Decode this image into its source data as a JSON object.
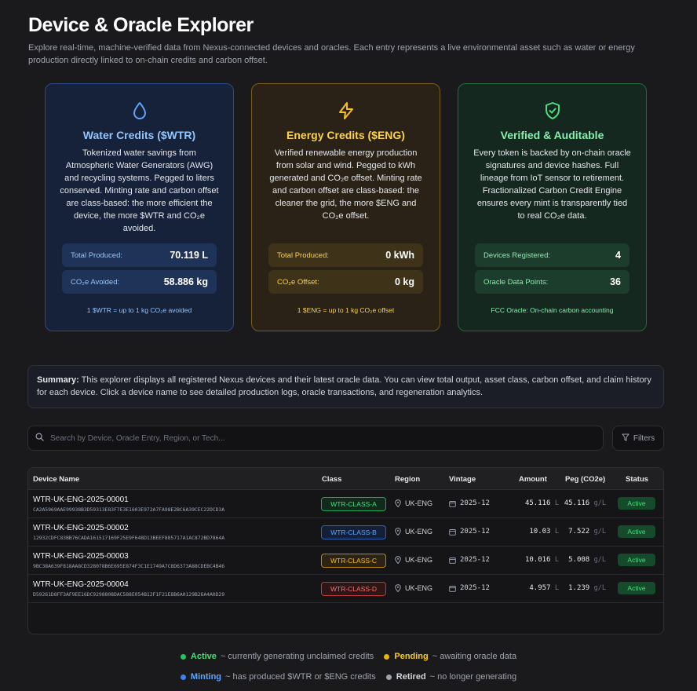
{
  "header": {
    "title": "Device & Oracle Explorer",
    "description": "Explore real-time, machine-verified data from Nexus-connected devices and oracles. Each entry represents a live environmental asset such as water or energy production directly linked to on-chain credits and carbon offset."
  },
  "cards": {
    "water": {
      "icon": "droplet-icon",
      "title": "Water Credits ($WTR)",
      "body": "Tokenized water savings from Atmospheric Water Generators (AWG) and recycling systems. Pegged to liters conserved. Minting rate and carbon offset are class-based: the more efficient the device, the more $WTR and CO₂e avoided.",
      "stat1_label": "Total Produced:",
      "stat1_value": "70.119 L",
      "stat2_label": "CO₂e Avoided:",
      "stat2_value": "58.886 kg",
      "footer": "1 $WTR = up to 1 kg CO₂e avoided",
      "accent": "#93c5fd"
    },
    "energy": {
      "icon": "lightning-icon",
      "title": "Energy Credits ($ENG)",
      "body": "Verified renewable energy production from solar and wind. Pegged to kWh generated and CO₂e offset. Minting rate and carbon offset are class-based: the cleaner the grid, the more $ENG and CO₂e offset.",
      "stat1_label": "Total Produced:",
      "stat1_value": "0 kWh",
      "stat2_label": "CO₂e Offset:",
      "stat2_value": "0 kg",
      "footer": "1 $ENG = up to 1 kg CO₂e offset",
      "accent": "#fcd34d"
    },
    "verify": {
      "icon": "shield-check-icon",
      "title": "Verified & Auditable",
      "body": "Every token is backed by on-chain oracle signatures and device hashes. Full lineage from IoT sensor to retirement. Fractionalized Carbon Credit Engine ensures every mint is transparently tied to real CO₂e data.",
      "stat1_label": "Devices Registered:",
      "stat1_value": "4",
      "stat2_label": "Oracle Data Points:",
      "stat2_value": "36",
      "footer": "FCC Oracle: On-chain carbon accounting",
      "accent": "#86efac"
    }
  },
  "summary": {
    "lead": "Summary:",
    "text": " This explorer displays all registered Nexus devices and their latest oracle data. You can view total output, asset class, carbon offset, and claim history for each device. Click a device name to see detailed production logs, oracle transactions, and regeneration analytics."
  },
  "search": {
    "placeholder": "Search by Device, Oracle Entry, Region, or Tech...",
    "value": ""
  },
  "filters_label": "Filters",
  "table": {
    "columns": [
      "Device Name",
      "Class",
      "Region",
      "Vintage",
      "Amount",
      "Peg (CO2e)",
      "Status"
    ],
    "rows": [
      {
        "name": "WTR-UK-ENG-2025-00001",
        "hash": "CA2A5969AAE99938B3D59313E83F7E3E1603E972A7FA98E2BC6A39CEC22DCD3A",
        "class": "WTR-CLASS-A",
        "region": "UK-ENG",
        "vintage": "2025-12",
        "amount": "45.116",
        "amount_unit": "L",
        "peg": "45.116",
        "peg_unit": "g/L",
        "status": "Active"
      },
      {
        "name": "WTR-UK-ENG-2025-00002",
        "hash": "12932CDFC83BB76CADA161517169F25E9F648D13BEEF885717A1AC872BD7864A",
        "class": "WTR-CLASS-B",
        "region": "UK-ENG",
        "vintage": "2025-12",
        "amount": "10.03",
        "amount_unit": "L",
        "peg": "7.522",
        "peg_unit": "g/L",
        "status": "Active"
      },
      {
        "name": "WTR-UK-ENG-2025-00003",
        "hash": "9BC38A639F818AA8CD328078B6E695E874F3C1E1749A7C8D6373A88CDEBC4B46",
        "class": "WTR-CLASS-C",
        "region": "UK-ENG",
        "vintage": "2025-12",
        "amount": "10.016",
        "amount_unit": "L",
        "peg": "5.008",
        "peg_unit": "g/L",
        "status": "Active"
      },
      {
        "name": "WTR-UK-ENG-2025-00004",
        "hash": "D59261D8FF3AF9EE16DC9298808DAC588E054B12F1F21E8B6A0129B26A4A0D29",
        "class": "WTR-CLASS-D",
        "region": "UK-ENG",
        "vintage": "2025-12",
        "amount": "4.957",
        "amount_unit": "L",
        "peg": "1.239",
        "peg_unit": "g/L",
        "status": "Active"
      }
    ]
  },
  "legend": {
    "active": {
      "label": "Active",
      "desc": "~ currently generating unclaimed credits",
      "color": "#22c55e"
    },
    "pending": {
      "label": "Pending",
      "desc": "~ awaiting oracle data",
      "color": "#eab308"
    },
    "minting": {
      "label": "Minting",
      "desc": "~ has produced $WTR or $ENG credits",
      "color": "#3b82f6"
    },
    "retired": {
      "label": "Retired",
      "desc": "~ no longer generating",
      "color": "#9ca3af"
    }
  }
}
